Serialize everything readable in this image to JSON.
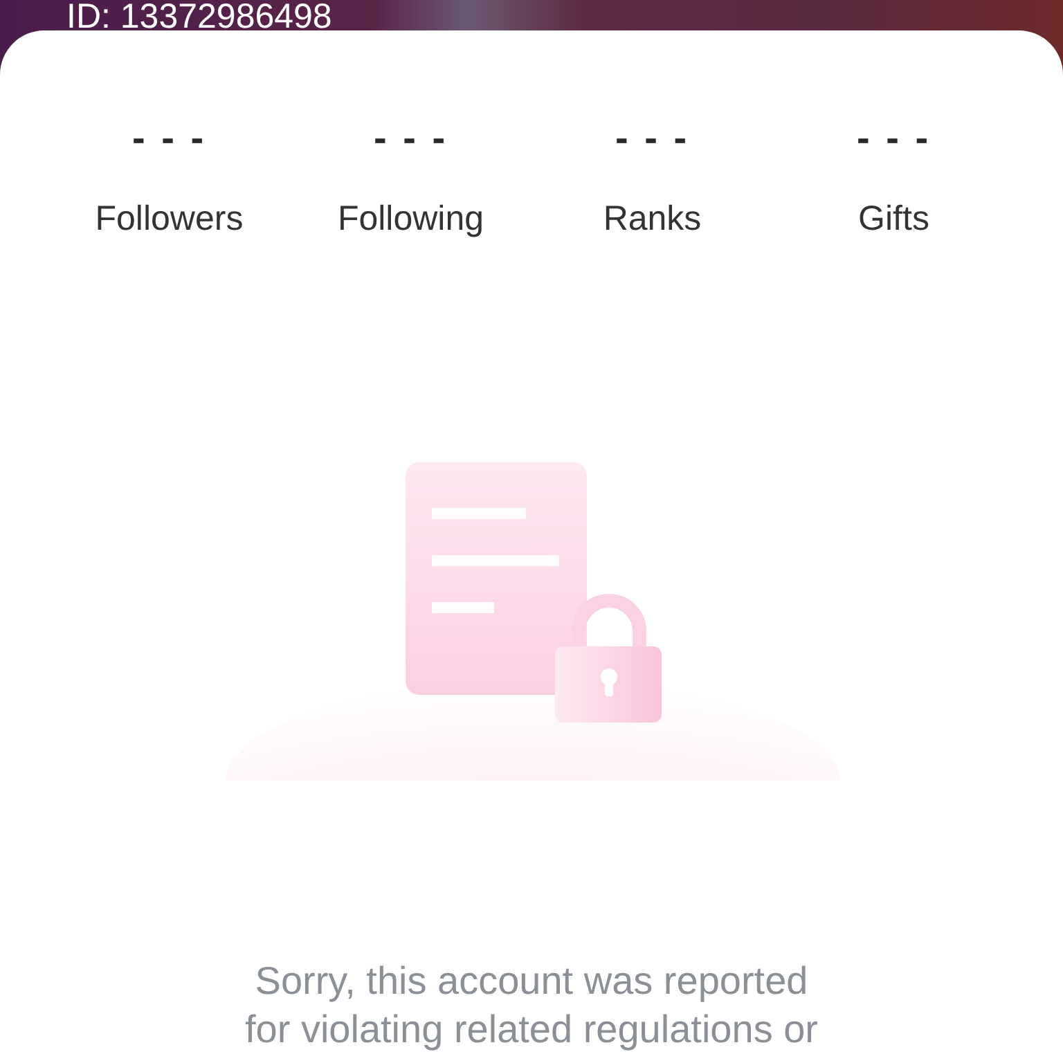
{
  "header": {
    "id_label": "ID: 13372986498"
  },
  "stats": [
    {
      "value": "- - -",
      "label": "Followers"
    },
    {
      "value": "- - -",
      "label": "Following"
    },
    {
      "value": "- - -",
      "label": "Ranks"
    },
    {
      "value": "- - -",
      "label": "Gifts"
    }
  ],
  "notice": {
    "message": "Sorry, this account was reported for violating related regulations or"
  }
}
